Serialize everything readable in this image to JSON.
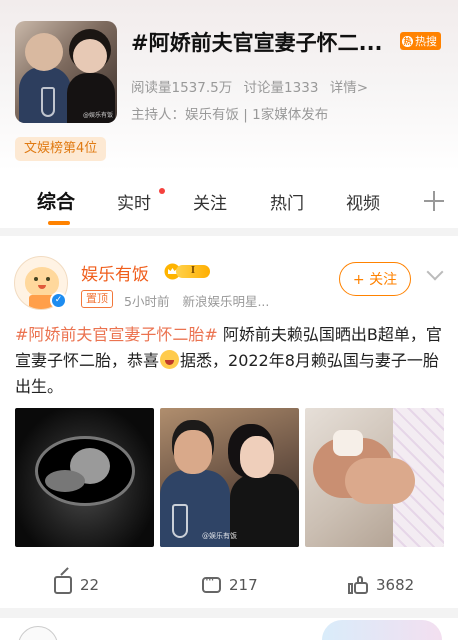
{
  "topic": {
    "title": "#阿娇前夫官宣妻子怀二...",
    "hot_badge": "热搜",
    "stats": {
      "reads": "阅读量1537.5万",
      "discussions": "讨论量1333",
      "details": "详情>"
    },
    "host": "主持人：娱乐有饭 | 1家媒体发布",
    "rank_badge": "文娱榜第4位",
    "cover_watermark": "@娱乐有饭"
  },
  "tabs": [
    {
      "label": "综合",
      "active": true
    },
    {
      "label": "实时",
      "active": false,
      "dot": true
    },
    {
      "label": "关注",
      "active": false
    },
    {
      "label": "热门",
      "active": false
    },
    {
      "label": "视频",
      "active": false
    }
  ],
  "post": {
    "author": "娱乐有饭",
    "level": "I",
    "pin": "置顶",
    "time": "5小时前",
    "source": "新浪娱乐明星...",
    "follow_label": "+ 关注",
    "text_tag": "#阿娇前夫官宣妻子怀二胎#",
    "text_part1": " 阿娇前夫赖弘国晒出B超单，官宣妻子怀二胎，恭喜",
    "text_part2": "据悉，2022年8月赖弘国与妻子一胎出生。",
    "photo2_watermark": "@娱乐有饭",
    "actions": {
      "share": "22",
      "comments": "217",
      "likes": "3682"
    }
  },
  "colors": {
    "accent": "#ff8200",
    "author": "#f05e1c",
    "hashtag": "#eb7350",
    "hot": "#ff8200",
    "rank_bg": "#fde9d3"
  },
  "icons": [
    "fire-icon",
    "plus-icon",
    "crown-icon",
    "verified-icon",
    "chevron-down-icon",
    "share-icon",
    "comment-icon",
    "like-icon"
  ]
}
